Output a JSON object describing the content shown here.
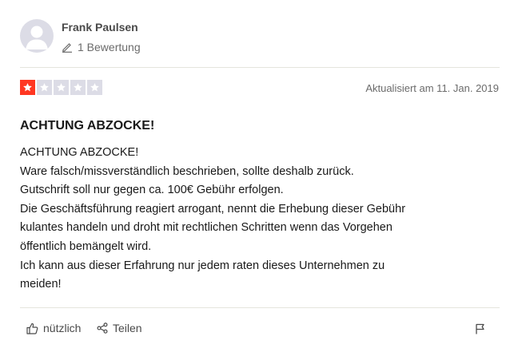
{
  "author": {
    "name": "Frank Paulsen",
    "review_count": "1 Bewertung",
    "avatar_icon": "user-silhouette-icon"
  },
  "rating": {
    "stars": 1,
    "max": 5,
    "filled_color": "#ff3722",
    "empty_color": "#dcdce6"
  },
  "date": "Aktualisiert am 11. Jan. 2019",
  "review": {
    "title": "ACHTUNG ABZOCKE!",
    "lines": [
      "ACHTUNG ABZOCKE!",
      "Ware falsch/missverständlich beschrieben, sollte deshalb zurück.",
      "Gutschrift soll nur gegen ca. 100€ Gebühr erfolgen.",
      "Die Geschäftsführung reagiert arrogant, nennt die Erhebung dieser Gebühr",
      "kulantes handeln und droht mit rechtlichen Schritten wenn das Vorgehen",
      "öffentlich bemängelt wird.",
      "Ich kann aus dieser Erfahrung nur jedem raten dieses Unternehmen zu",
      "meiden!"
    ]
  },
  "actions": {
    "helpful_label": "nützlich",
    "share_label": "Teilen"
  }
}
